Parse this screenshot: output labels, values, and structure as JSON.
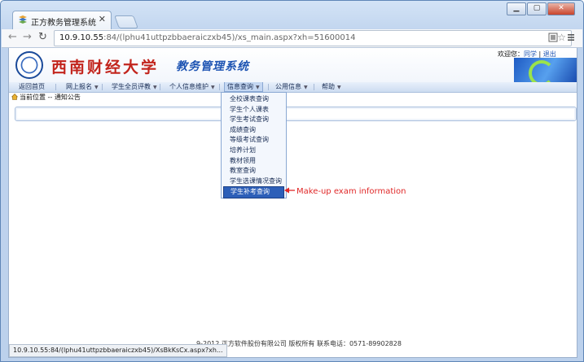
{
  "browser": {
    "tab_title": "正方教务管理系统",
    "url_host": "10.9.10.55",
    "url_path": ":84/(lphu41uttpzbbaeraiczxb45)/xs_main.aspx?xh=51600014",
    "status_url": "10.9.10.55:84/(lphu41uttpzbbaeraiczxb45)/XsBkKsCx.aspx?xh..."
  },
  "header": {
    "university": "西南财经大学",
    "system_title": "教务管理系统",
    "welcome": "欢迎您：",
    "user_link": "同学",
    "logout": "退出"
  },
  "menubar": {
    "items": [
      {
        "label": "返回首页"
      },
      {
        "label": "网上报名"
      },
      {
        "label": "学生全员评教"
      },
      {
        "label": "个人信息维护"
      },
      {
        "label": "信息查询"
      },
      {
        "label": "公用信息"
      },
      {
        "label": "帮助"
      }
    ]
  },
  "breadcrumb": {
    "text": "当前位置 -- 通知公告"
  },
  "dropdown": {
    "items": [
      "全校课表查询",
      "学生个人课表",
      "学生考试查询",
      "成绩查询",
      "等级考试查询",
      "培养计划",
      "教材领用",
      "教室查询",
      "学生选课情况查询",
      "学生补考查询"
    ]
  },
  "annotation": {
    "text": "Make-up exam information",
    "color": "#e02828"
  },
  "footer": {
    "text": "9-2012  正方软件股份有限公司 版权所有  联系电话：0571-89902828"
  }
}
